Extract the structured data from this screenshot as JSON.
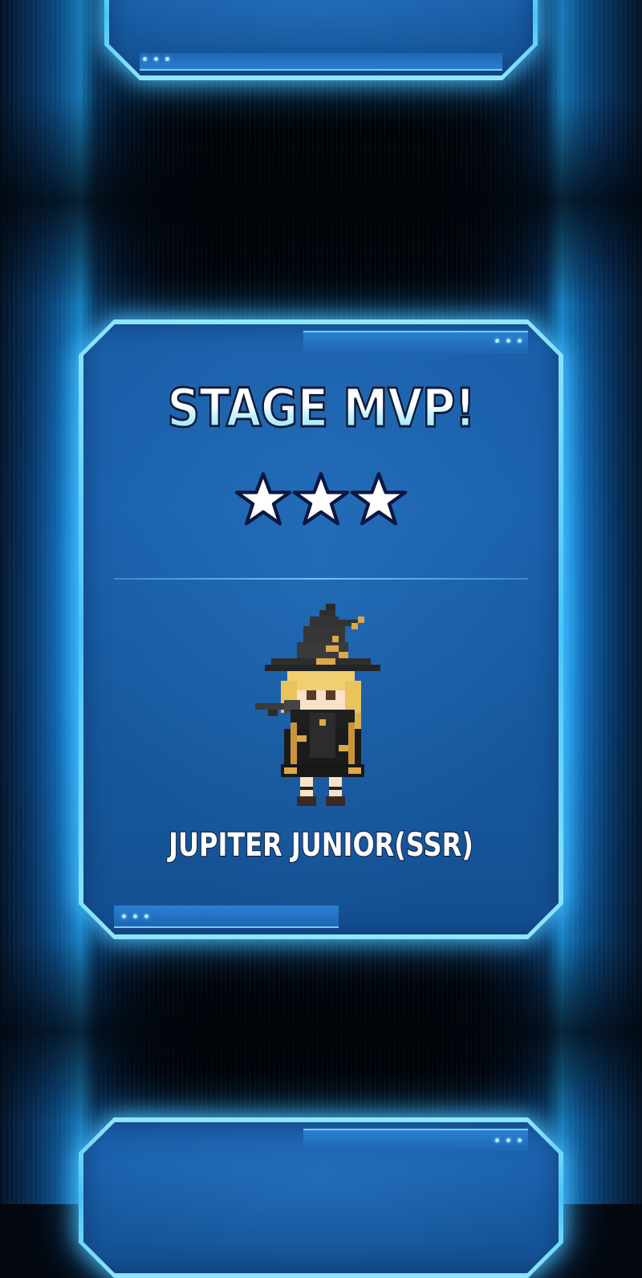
{
  "screen": {
    "title": "STAGE MVP!",
    "stars": {
      "filled": 3,
      "total": 3
    },
    "character": {
      "name": "JUPITER JUNIOR(SSR)",
      "sprite_icon": "witch-character-sprite"
    }
  },
  "colors": {
    "panel_fill": "#1a5fa8",
    "panel_border": "#6fd3ff",
    "title_gradient_bottom": "#7fe0f5",
    "outline": "#0a1a3e",
    "star_fill": "#ffffff",
    "star_outline": "#0b1740",
    "background": "#03070f",
    "side_glow": "#1e9ee8"
  },
  "icons": {
    "star": "star-icon",
    "dots": "ellipsis-dots-icon"
  }
}
